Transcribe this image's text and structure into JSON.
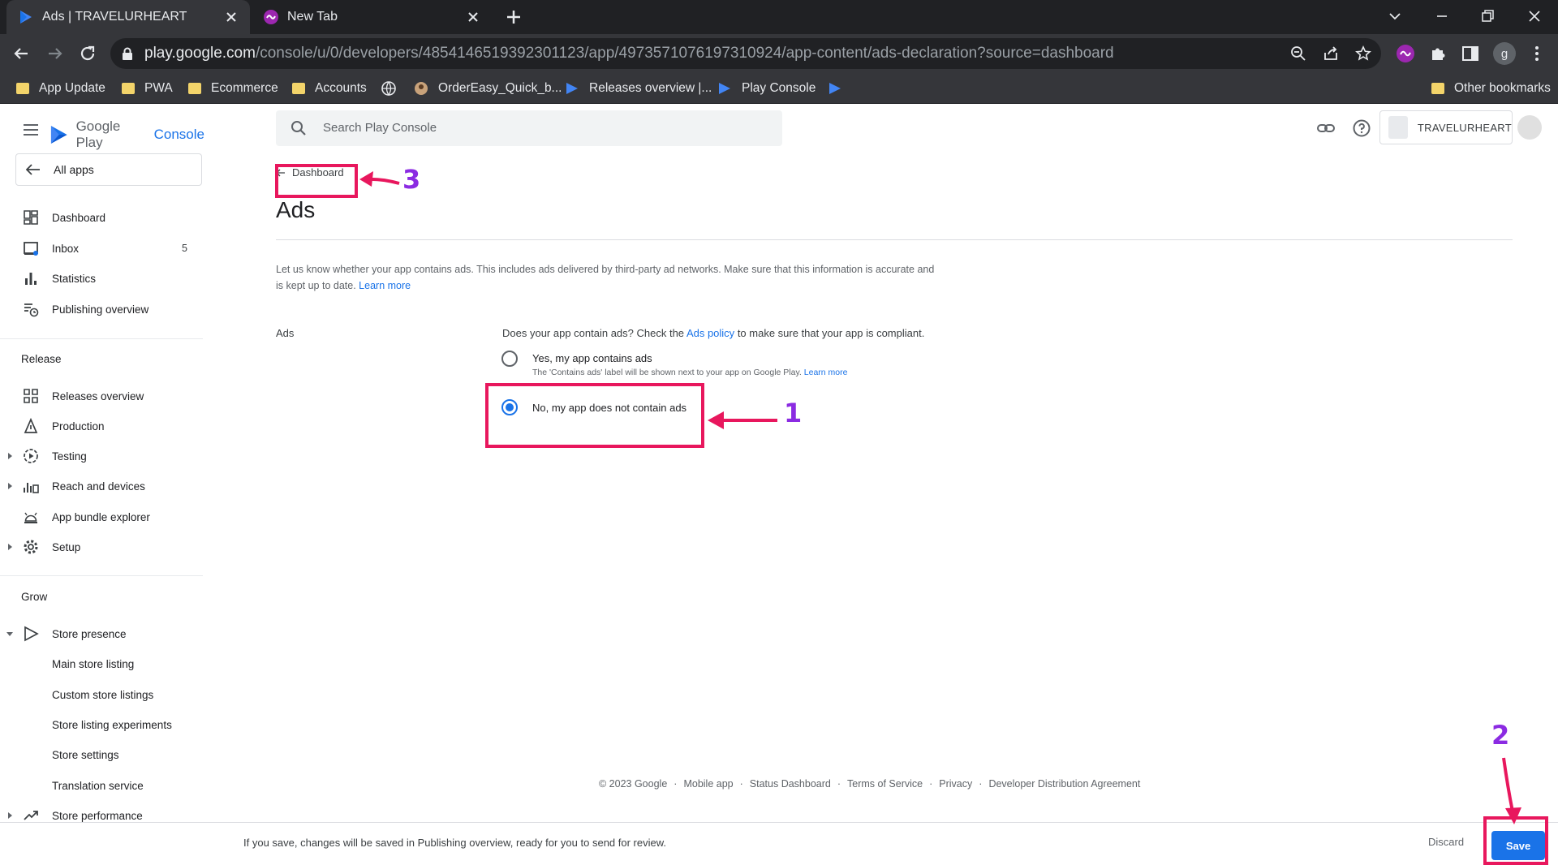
{
  "browser": {
    "tabs": [
      {
        "title": "Ads | TRAVELURHEART",
        "active": true
      },
      {
        "title": "New Tab",
        "active": false
      }
    ],
    "url_host": "play.google.com",
    "url_path": "/console/u/0/developers/4854146519392301123/app/4973571076197310924/app-content/ads-declaration?source=dashboard",
    "profile_letter": "g",
    "bookmarks": [
      {
        "label": "App Update",
        "icon": "folder-icon"
      },
      {
        "label": "PWA",
        "icon": "folder-icon"
      },
      {
        "label": "Ecommerce",
        "icon": "folder-icon"
      },
      {
        "label": "Accounts",
        "icon": "folder-icon"
      },
      {
        "label": "",
        "icon": "globe-icon"
      },
      {
        "label": "OrderEasy_Quick_b...",
        "icon": "avatar-icon"
      },
      {
        "label": "Releases overview |...",
        "icon": "play-console-icon"
      },
      {
        "label": "Play Console",
        "icon": "play-console-icon"
      },
      {
        "label": "",
        "icon": "play-console-icon"
      }
    ],
    "other_bookmarks": "Other bookmarks"
  },
  "console": {
    "logo_text": "Google Play",
    "logo_console": "Console",
    "all_apps": "All apps",
    "search_placeholder": "Search Play Console",
    "account_name": "TRAVELURHEART",
    "nav": {
      "dashboard": "Dashboard",
      "inbox": "Inbox",
      "inbox_count": "5",
      "statistics": "Statistics",
      "publishing_overview": "Publishing overview",
      "release_section": "Release",
      "releases_overview": "Releases overview",
      "production": "Production",
      "testing": "Testing",
      "reach_devices": "Reach and devices",
      "bundle_explorer": "App bundle explorer",
      "setup": "Setup",
      "grow_section": "Grow",
      "store_presence": "Store presence",
      "main_store_listing": "Main store listing",
      "custom_store_listings": "Custom store listings",
      "store_listing_experiments": "Store listing experiments",
      "store_settings": "Store settings",
      "translation_service": "Translation service",
      "store_performance": "Store performance"
    }
  },
  "page": {
    "breadcrumb": "Dashboard",
    "title": "Ads",
    "intro_text": "Let us know whether your app contains ads. This includes ads delivered by third-party ad networks. Make sure that this information is accurate and is kept up to date.",
    "intro_link": "Learn more",
    "ads_label": "Ads",
    "question_before": "Does your app contain ads? Check the",
    "question_link": "Ads policy",
    "question_after": "to make sure that your app is compliant.",
    "option_yes": "Yes, my app contains ads",
    "option_yes_help": "The 'Contains ads' label will be shown next to your app on Google Play.",
    "option_yes_help_link": "Learn more",
    "option_no": "No, my app does not contain ads",
    "selected_option": "no"
  },
  "footer": {
    "copyright": "© 2023 Google",
    "links": [
      "Mobile app",
      "Status Dashboard",
      "Terms of Service",
      "Privacy",
      "Developer Distribution Agreement"
    ]
  },
  "save_bar": {
    "message": "If you save, changes will be saved in Publishing overview, ready for you to send for review.",
    "discard": "Discard",
    "save": "Save"
  },
  "annotations": {
    "step1": "1",
    "step2": "2",
    "step3": "3",
    "color_box": "#e8175d",
    "color_number": "#8b2be2"
  }
}
